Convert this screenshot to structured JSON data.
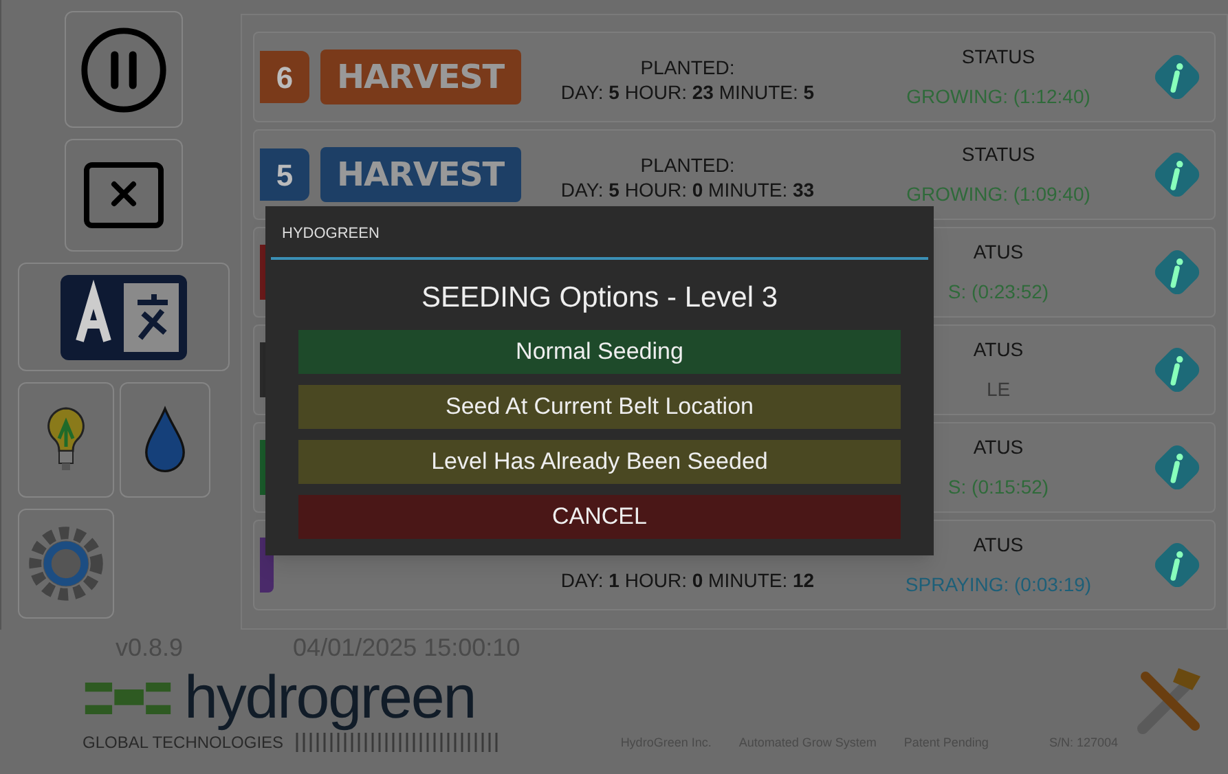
{
  "rows": [
    {
      "number": "6",
      "crop": "HARVEST",
      "color": "#7a3a1a",
      "planted_label": "PLANTED:",
      "planted": "DAY: **5** HOUR: **23**  MINUTE: **5**",
      "status": {
        "label": "STATUS",
        "text": "GROWING: (1:12:40)",
        "color": "#2f6a3a"
      }
    },
    {
      "number": "5",
      "crop": "HARVEST",
      "color": "#1d3f66",
      "planted_label": "PLANTED:",
      "planted": "DAY: **5** HOUR: **0**  MINUTE: **33**",
      "status": {
        "label": "STATUS",
        "text": "GROWING: (1:09:40)",
        "color": "#2f6a3a"
      }
    },
    {
      "color": "#6a1a1a",
      "status": {
        "label": "ATUS",
        "text": "S: (0:23:52)",
        "color": "#2f6a3a"
      }
    },
    {
      "color": "#2a2a2a",
      "status": {
        "label": "ATUS",
        "text": "LE",
        "color": "#3a3a3a"
      }
    },
    {
      "color": "#1a5a2a",
      "status": {
        "label": "ATUS",
        "text": "S: (0:15:52)",
        "color": "#2f6a3a"
      }
    },
    {
      "color": "#4a2a6a",
      "planted": "DAY: **1** HOUR: **0**  MINUTE: **12**",
      "status": {
        "label": "ATUS",
        "text": "SPRAYING: (0:03:19)",
        "color": "#1d5f78"
      }
    }
  ],
  "footer": {
    "version": "v0.8.9",
    "datetime": "04/01/2025 15:00:10",
    "logo": "hydrogreen",
    "tagline": "GLOBAL TECHNOLOGIES",
    "company": "HydroGreen Inc.",
    "product": "Automated Grow System",
    "patent": "Patent Pending",
    "serial": "S/N: 127004"
  },
  "dialog": {
    "title": "HYDOGREEN",
    "heading": "SEEDING Options - Level 3",
    "options": [
      {
        "label": "Normal Seeding",
        "kind": "primary"
      },
      {
        "label": "Seed At Current Belt Location",
        "kind": "alternate"
      },
      {
        "label": "Level Has Already Been Seeded",
        "kind": "alternate"
      },
      {
        "label": "CANCEL",
        "kind": "cancel"
      }
    ]
  }
}
